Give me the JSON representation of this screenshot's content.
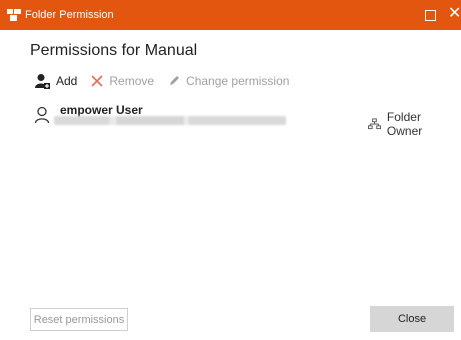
{
  "window": {
    "title": "Folder Permission",
    "accent_color": "#e2560f",
    "icon": "folder-share-icon"
  },
  "heading": "Permissions for Manual",
  "toolbar": {
    "add_label": "Add",
    "remove_label": "Remove",
    "change_label": "Change permission"
  },
  "users": [
    {
      "name": "empower User",
      "email": "",
      "role": "Folder Owner",
      "icon": "user-icon",
      "role_icon": "hierarchy-icon"
    }
  ],
  "footer": {
    "reset_label": "Reset permissions",
    "close_label": "Close"
  }
}
